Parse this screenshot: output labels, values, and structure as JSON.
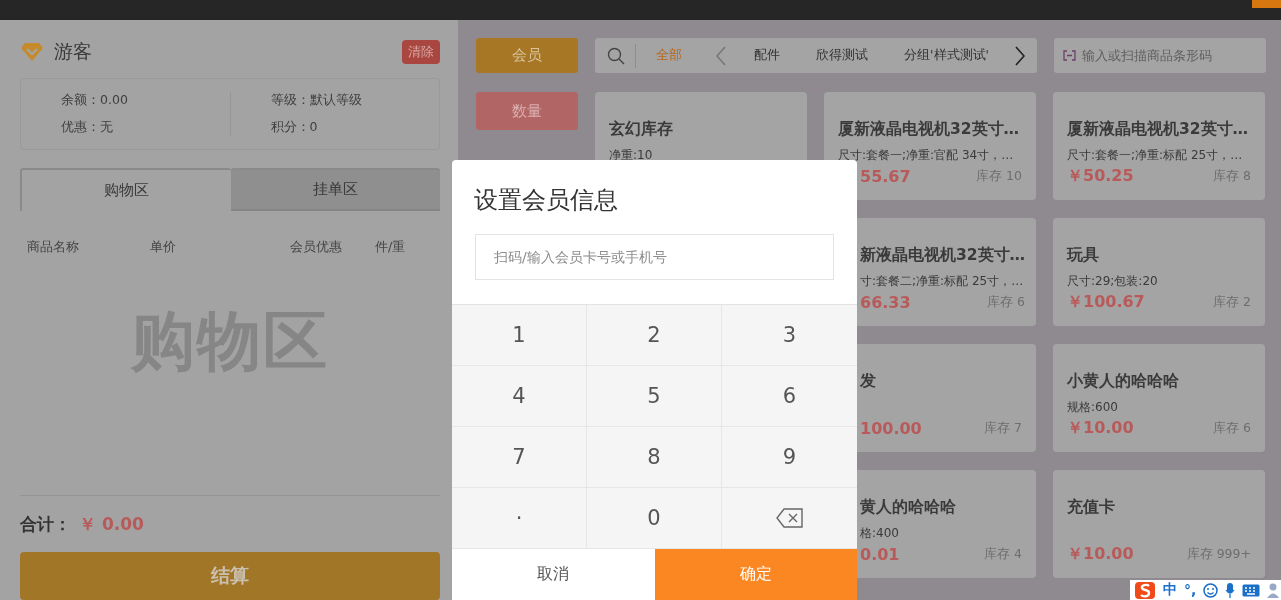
{
  "member": {
    "name": "游客",
    "clear_button": "清除",
    "info_columns": [
      [
        "余额：0.00",
        "优惠：无"
      ],
      [
        "等级：默认等级",
        "积分：0"
      ]
    ]
  },
  "cart_tabs": [
    {
      "label": "购物区",
      "selected": true
    },
    {
      "label": "挂单区",
      "selected": false
    }
  ],
  "cart_columns": [
    "商品名称",
    "单价",
    "会员优惠",
    "件/重"
  ],
  "cart_empty": "购物区",
  "total": {
    "label": "合计：",
    "amount": "￥ 0.00"
  },
  "checkout_button": "结算",
  "side_buttons": [
    {
      "label": "会员",
      "kind": "member"
    },
    {
      "label": "数量",
      "kind": "quantity"
    }
  ],
  "categories": [
    {
      "label": "全部",
      "selected": true
    },
    {
      "label": "配件",
      "selected": false
    },
    {
      "label": "欣得测试",
      "selected": false
    },
    {
      "label": "分组'样式测试'",
      "selected": false
    }
  ],
  "scan_field": {
    "placeholder": "输入或扫描商品条形码"
  },
  "product_columns": [
    [
      {
        "title": {
          "text": "玄幻库存",
          "covered": false
        },
        "spec": {
          "text": "净重:10",
          "covered": false
        }
      }
    ],
    [
      {
        "title": {
          "text": "厦新液晶电视机32英寸…",
          "covered": false
        },
        "spec": {
          "text": "尺寸:套餐一;净重:官配 34寸，…",
          "covered": false
        },
        "price": {
          "text": "55.67",
          "covered": true
        },
        "stock": "库存 10"
      },
      {
        "title": {
          "text": "新液晶电视机32英寸…",
          "covered": true
        },
        "spec": {
          "text": "寸:套餐二;净重:标配 25寸，…",
          "covered": true
        },
        "price": {
          "text": "66.33",
          "covered": true
        },
        "stock": "库存 6"
      },
      {
        "title": {
          "text": "发",
          "covered": true
        },
        "price": {
          "text": "100.00",
          "covered": true
        },
        "stock": "库存 7"
      },
      {
        "title": {
          "text": "黄人的哈哈哈",
          "covered": true
        },
        "spec": {
          "text": "格:400",
          "covered": true
        },
        "price": {
          "text": "0.01",
          "covered": true
        },
        "stock": "库存 4"
      }
    ],
    [
      {
        "title": {
          "text": "厦新液晶电视机32英寸…",
          "covered": false
        },
        "spec": {
          "text": "尺寸:套餐一;净重:标配 25寸，…",
          "covered": false
        },
        "price": {
          "text": "￥50.25",
          "covered": false
        },
        "stock": "库存 8"
      },
      {
        "title": {
          "text": "玩具",
          "covered": false
        },
        "spec": {
          "text": "尺寸:29;包装:20",
          "covered": false
        },
        "price": {
          "text": "￥100.67",
          "covered": false
        },
        "stock": "库存 2"
      },
      {
        "title": {
          "text": "小黄人的哈哈哈",
          "covered": false
        },
        "spec": {
          "text": "规格:600",
          "covered": false
        },
        "price": {
          "text": "￥10.00",
          "covered": false
        },
        "stock": "库存 6"
      },
      {
        "title": {
          "text": "充值卡",
          "covered": false
        },
        "price": {
          "text": "￥10.00",
          "covered": false
        },
        "stock": "库存 999+"
      }
    ]
  ],
  "dialog": {
    "title": "设置会员信息",
    "input": {
      "placeholder": "扫码/输入会员卡号或手机号"
    },
    "keys": [
      {
        "kind": "digit",
        "label": "1"
      },
      {
        "kind": "digit",
        "label": "2"
      },
      {
        "kind": "digit",
        "label": "3"
      },
      {
        "kind": "digit",
        "label": "4"
      },
      {
        "kind": "digit",
        "label": "5"
      },
      {
        "kind": "digit",
        "label": "6"
      },
      {
        "kind": "digit",
        "label": "7"
      },
      {
        "kind": "digit",
        "label": "8"
      },
      {
        "kind": "digit",
        "label": "9"
      },
      {
        "kind": "point",
        "label": "."
      },
      {
        "kind": "digit",
        "label": "0"
      },
      {
        "kind": "backspace"
      }
    ],
    "cancel": "取消",
    "confirm": "确定"
  },
  "ime_bar": {
    "mode": "中",
    "punctuation": "°,"
  }
}
